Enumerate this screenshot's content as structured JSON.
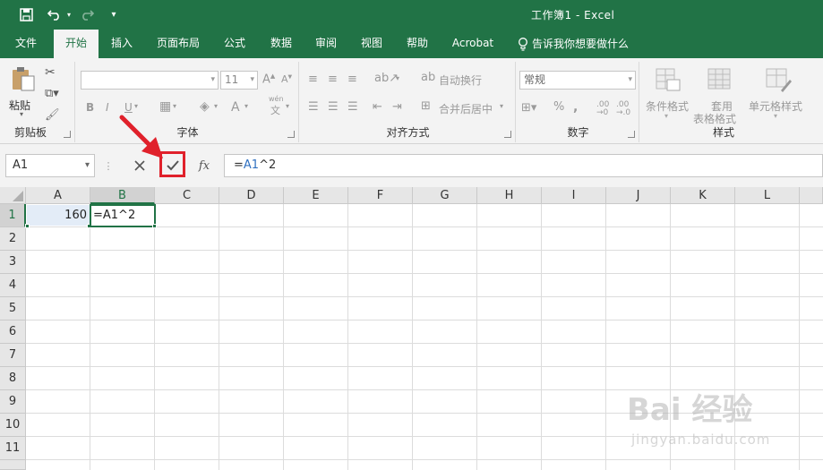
{
  "window": {
    "title": "工作簿1  -  Excel"
  },
  "tabs": [
    "文件",
    "开始",
    "插入",
    "页面布局",
    "公式",
    "数据",
    "审阅",
    "视图",
    "帮助",
    "Acrobat"
  ],
  "tell_me": "告诉我你想要做什么",
  "ribbon": {
    "clipboard": {
      "paste": "粘贴",
      "label": "剪贴板"
    },
    "font": {
      "size": "11",
      "bold": "B",
      "italic": "I",
      "underline": "U",
      "label": "字体",
      "phonetic": "wén"
    },
    "alignment": {
      "wrap": "自动换行",
      "merge": "合并后居中",
      "label": "对齐方式"
    },
    "number": {
      "format": "常规",
      "label": "数字"
    },
    "styles": {
      "conditional": "条件格式",
      "table1": "套用",
      "table2": "表格格式",
      "cell": "单元格样式",
      "label": "样式"
    }
  },
  "formula_bar": {
    "name_box": "A1",
    "fx": "fx",
    "formula_prefix": "=",
    "formula_ref": "A1",
    "formula_suffix": "^2"
  },
  "columns": [
    "A",
    "B",
    "C",
    "D",
    "E",
    "F",
    "G",
    "H",
    "I",
    "J",
    "K",
    "L"
  ],
  "rows": [
    "1",
    "2",
    "3",
    "4",
    "5",
    "6",
    "7",
    "8",
    "9",
    "10",
    "11"
  ],
  "cells": {
    "A1": "160",
    "B1": "=A1^2"
  },
  "watermark": {
    "main": "Bai  经验",
    "url": "jingyan.baidu.com"
  },
  "colors": {
    "accent": "#217346",
    "highlight": "#e0212b"
  }
}
